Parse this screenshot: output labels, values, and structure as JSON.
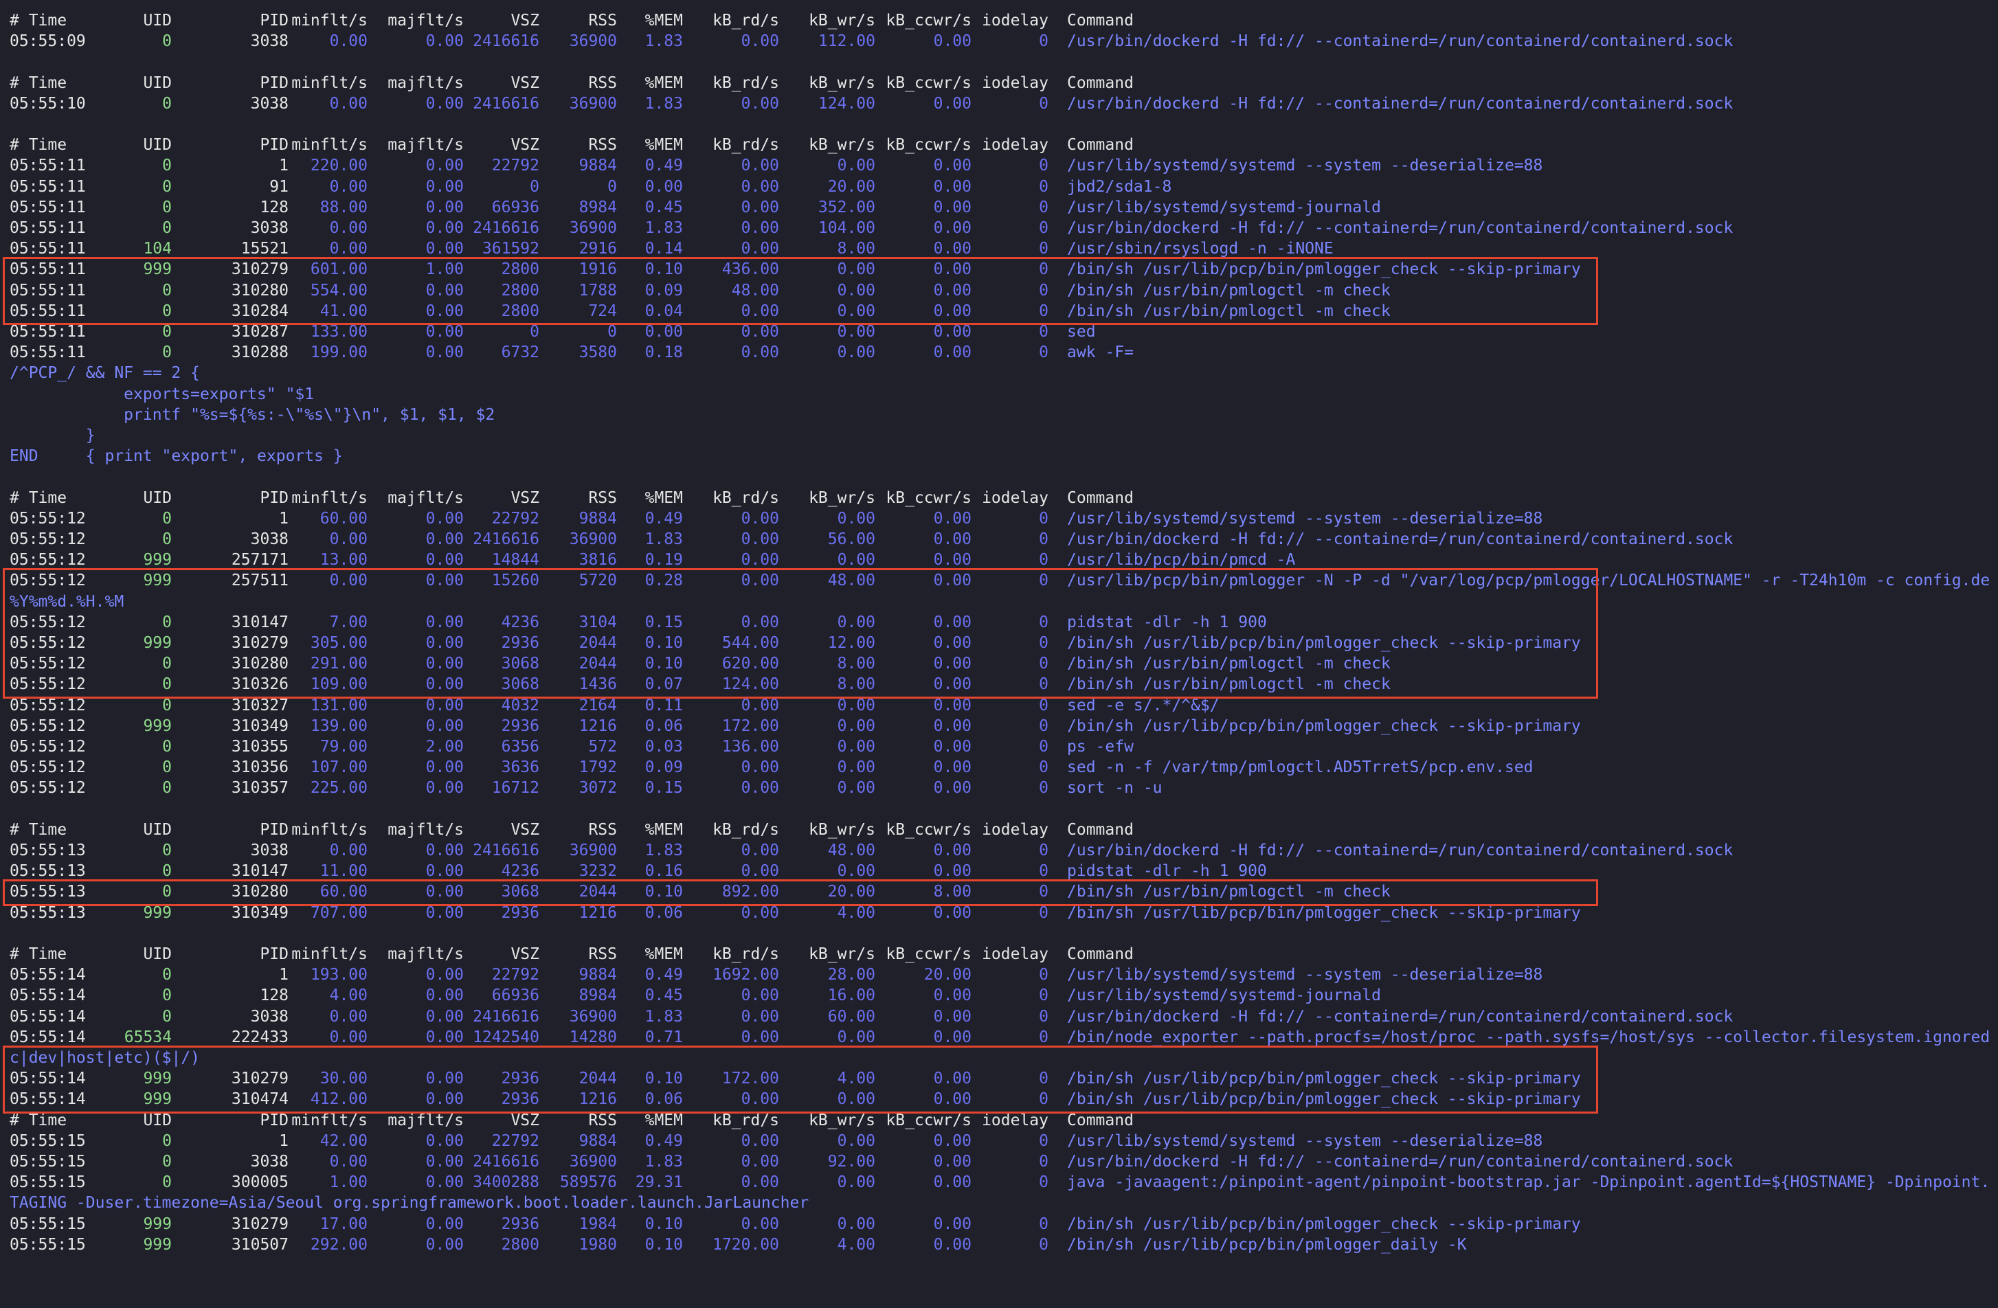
{
  "header": [
    "# Time",
    "UID",
    "PID",
    "minflt/s",
    "majflt/s",
    "VSZ",
    "RSS",
    "%MEM",
    "kB_rd/s",
    "kB_wr/s",
    "kB_ccwr/s",
    "iodelay",
    "Command"
  ],
  "blocks": [
    {
      "rows": [
        [
          "05:55:09",
          "0",
          "3038",
          "0.00",
          "0.00",
          "2416616",
          "36900",
          "1.83",
          "0.00",
          "112.00",
          "0.00",
          "0",
          "/usr/bin/dockerd -H fd:// --containerd=/run/containerd/containerd.sock"
        ]
      ]
    },
    {
      "rows": [
        [
          "05:55:10",
          "0",
          "3038",
          "0.00",
          "0.00",
          "2416616",
          "36900",
          "1.83",
          "0.00",
          "124.00",
          "0.00",
          "0",
          "/usr/bin/dockerd -H fd:// --containerd=/run/containerd/containerd.sock"
        ]
      ]
    },
    {
      "rows": [
        [
          "05:55:11",
          "0",
          "1",
          "220.00",
          "0.00",
          "22792",
          "9884",
          "0.49",
          "0.00",
          "0.00",
          "0.00",
          "0",
          "/usr/lib/systemd/systemd --system --deserialize=88"
        ],
        [
          "05:55:11",
          "0",
          "91",
          "0.00",
          "0.00",
          "0",
          "0",
          "0.00",
          "0.00",
          "20.00",
          "0.00",
          "0",
          "jbd2/sda1-8"
        ],
        [
          "05:55:11",
          "0",
          "128",
          "88.00",
          "0.00",
          "66936",
          "8984",
          "0.45",
          "0.00",
          "352.00",
          "0.00",
          "0",
          "/usr/lib/systemd/systemd-journald"
        ],
        [
          "05:55:11",
          "0",
          "3038",
          "0.00",
          "0.00",
          "2416616",
          "36900",
          "1.83",
          "0.00",
          "104.00",
          "0.00",
          "0",
          "/usr/bin/dockerd -H fd:// --containerd=/run/containerd/containerd.sock"
        ],
        [
          "05:55:11",
          "104",
          "15521",
          "0.00",
          "0.00",
          "361592",
          "2916",
          "0.14",
          "0.00",
          "8.00",
          "0.00",
          "0",
          "/usr/sbin/rsyslogd -n -iNONE"
        ],
        [
          "05:55:11",
          "999",
          "310279",
          "601.00",
          "1.00",
          "2800",
          "1916",
          "0.10",
          "436.00",
          "0.00",
          "0.00",
          "0",
          "/bin/sh /usr/lib/pcp/bin/pmlogger_check --skip-primary"
        ],
        [
          "05:55:11",
          "0",
          "310280",
          "554.00",
          "0.00",
          "2800",
          "1788",
          "0.09",
          "48.00",
          "0.00",
          "0.00",
          "0",
          "/bin/sh /usr/bin/pmlogctl -m check"
        ],
        [
          "05:55:11",
          "0",
          "310284",
          "41.00",
          "0.00",
          "2800",
          "724",
          "0.04",
          "0.00",
          "0.00",
          "0.00",
          "0",
          "/bin/sh /usr/bin/pmlogctl -m check"
        ],
        [
          "05:55:11",
          "0",
          "310287",
          "133.00",
          "0.00",
          "0",
          "0",
          "0.00",
          "0.00",
          "0.00",
          "0.00",
          "0",
          "sed"
        ],
        [
          "05:55:11",
          "0",
          "310288",
          "199.00",
          "0.00",
          "6732",
          "3580",
          "0.18",
          "0.00",
          "0.00",
          "0.00",
          "0",
          "awk -F="
        ],
        {
          "wrap": "/^PCP_/ && NF == 2 {"
        },
        {
          "wrap": "            exports=exports\" \"$1"
        },
        {
          "wrap": "            printf \"%s=${%s:-\\\"%s\\\"}\\n\", $1, $1, $2"
        },
        {
          "wrap": "        }"
        },
        {
          "wrap": "END     { print \"export\", exports }"
        }
      ]
    },
    {
      "rows": [
        [
          "05:55:12",
          "0",
          "1",
          "60.00",
          "0.00",
          "22792",
          "9884",
          "0.49",
          "0.00",
          "0.00",
          "0.00",
          "0",
          "/usr/lib/systemd/systemd --system --deserialize=88"
        ],
        [
          "05:55:12",
          "0",
          "3038",
          "0.00",
          "0.00",
          "2416616",
          "36900",
          "1.83",
          "0.00",
          "56.00",
          "0.00",
          "0",
          "/usr/bin/dockerd -H fd:// --containerd=/run/containerd/containerd.sock"
        ],
        [
          "05:55:12",
          "999",
          "257171",
          "13.00",
          "0.00",
          "14844",
          "3816",
          "0.19",
          "0.00",
          "0.00",
          "0.00",
          "0",
          "/usr/lib/pcp/bin/pmcd -A"
        ],
        [
          "05:55:12",
          "999",
          "257511",
          "0.00",
          "0.00",
          "15260",
          "5720",
          "0.28",
          "0.00",
          "48.00",
          "0.00",
          "0",
          "/usr/lib/pcp/bin/pmlogger -N -P -d \"/var/log/pcp/pmlogger/LOCALHOSTNAME\" -r -T24h10m -c config.de"
        ],
        {
          "wrap": "%Y%m%d.%H.%M"
        },
        [
          "05:55:12",
          "0",
          "310147",
          "7.00",
          "0.00",
          "4236",
          "3104",
          "0.15",
          "0.00",
          "0.00",
          "0.00",
          "0",
          "pidstat -dlr -h 1 900"
        ],
        [
          "05:55:12",
          "999",
          "310279",
          "305.00",
          "0.00",
          "2936",
          "2044",
          "0.10",
          "544.00",
          "12.00",
          "0.00",
          "0",
          "/bin/sh /usr/lib/pcp/bin/pmlogger_check --skip-primary"
        ],
        [
          "05:55:12",
          "0",
          "310280",
          "291.00",
          "0.00",
          "3068",
          "2044",
          "0.10",
          "620.00",
          "8.00",
          "0.00",
          "0",
          "/bin/sh /usr/bin/pmlogctl -m check"
        ],
        [
          "05:55:12",
          "0",
          "310326",
          "109.00",
          "0.00",
          "3068",
          "1436",
          "0.07",
          "124.00",
          "8.00",
          "0.00",
          "0",
          "/bin/sh /usr/bin/pmlogctl -m check"
        ],
        [
          "05:55:12",
          "0",
          "310327",
          "131.00",
          "0.00",
          "4032",
          "2164",
          "0.11",
          "0.00",
          "0.00",
          "0.00",
          "0",
          "sed -e s/.*/^&$/"
        ],
        [
          "05:55:12",
          "999",
          "310349",
          "139.00",
          "0.00",
          "2936",
          "1216",
          "0.06",
          "172.00",
          "0.00",
          "0.00",
          "0",
          "/bin/sh /usr/lib/pcp/bin/pmlogger_check --skip-primary"
        ],
        [
          "05:55:12",
          "0",
          "310355",
          "79.00",
          "2.00",
          "6356",
          "572",
          "0.03",
          "136.00",
          "0.00",
          "0.00",
          "0",
          "ps -efw"
        ],
        [
          "05:55:12",
          "0",
          "310356",
          "107.00",
          "0.00",
          "3636",
          "1792",
          "0.09",
          "0.00",
          "0.00",
          "0.00",
          "0",
          "sed -n -f /var/tmp/pmlogctl.AD5TrretS/pcp.env.sed"
        ],
        [
          "05:55:12",
          "0",
          "310357",
          "225.00",
          "0.00",
          "16712",
          "3072",
          "0.15",
          "0.00",
          "0.00",
          "0.00",
          "0",
          "sort -n -u"
        ]
      ]
    },
    {
      "rows": [
        [
          "05:55:13",
          "0",
          "3038",
          "0.00",
          "0.00",
          "2416616",
          "36900",
          "1.83",
          "0.00",
          "48.00",
          "0.00",
          "0",
          "/usr/bin/dockerd -H fd:// --containerd=/run/containerd/containerd.sock"
        ],
        [
          "05:55:13",
          "0",
          "310147",
          "11.00",
          "0.00",
          "4236",
          "3232",
          "0.16",
          "0.00",
          "0.00",
          "0.00",
          "0",
          "pidstat -dlr -h 1 900"
        ],
        [
          "05:55:13",
          "0",
          "310280",
          "60.00",
          "0.00",
          "3068",
          "2044",
          "0.10",
          "892.00",
          "20.00",
          "8.00",
          "0",
          "/bin/sh /usr/bin/pmlogctl -m check"
        ],
        [
          "05:55:13",
          "999",
          "310349",
          "707.00",
          "0.00",
          "2936",
          "1216",
          "0.06",
          "0.00",
          "4.00",
          "0.00",
          "0",
          "/bin/sh /usr/lib/pcp/bin/pmlogger_check --skip-primary"
        ]
      ]
    },
    {
      "rows": [
        [
          "05:55:14",
          "0",
          "1",
          "193.00",
          "0.00",
          "22792",
          "9884",
          "0.49",
          "1692.00",
          "28.00",
          "20.00",
          "0",
          "/usr/lib/systemd/systemd --system --deserialize=88"
        ],
        [
          "05:55:14",
          "0",
          "128",
          "4.00",
          "0.00",
          "66936",
          "8984",
          "0.45",
          "0.00",
          "16.00",
          "0.00",
          "0",
          "/usr/lib/systemd/systemd-journald"
        ],
        [
          "05:55:14",
          "0",
          "3038",
          "0.00",
          "0.00",
          "2416616",
          "36900",
          "1.83",
          "0.00",
          "60.00",
          "0.00",
          "0",
          "/usr/bin/dockerd -H fd:// --containerd=/run/containerd/containerd.sock"
        ],
        [
          "05:55:14",
          "65534",
          "222433",
          "0.00",
          "0.00",
          "1242540",
          "14280",
          "0.71",
          "0.00",
          "0.00",
          "0.00",
          "0",
          "/bin/node_exporter --path.procfs=/host/proc --path.sysfs=/host/sys --collector.filesystem.ignored"
        ],
        {
          "wrap": "c|dev|host|etc)($|/)"
        },
        [
          "05:55:14",
          "999",
          "310279",
          "30.00",
          "0.00",
          "2936",
          "2044",
          "0.10",
          "172.00",
          "4.00",
          "0.00",
          "0",
          "/bin/sh /usr/lib/pcp/bin/pmlogger_check --skip-primary"
        ],
        [
          "05:55:14",
          "999",
          "310474",
          "412.00",
          "0.00",
          "2936",
          "1216",
          "0.06",
          "0.00",
          "0.00",
          "0.00",
          "0",
          "/bin/sh /usr/lib/pcp/bin/pmlogger_check --skip-primary"
        ]
      ]
    },
    {
      "nogap": true,
      "rows": [
        [
          "05:55:15",
          "0",
          "1",
          "42.00",
          "0.00",
          "22792",
          "9884",
          "0.49",
          "0.00",
          "0.00",
          "0.00",
          "0",
          "/usr/lib/systemd/systemd --system --deserialize=88"
        ],
        [
          "05:55:15",
          "0",
          "3038",
          "0.00",
          "0.00",
          "2416616",
          "36900",
          "1.83",
          "0.00",
          "92.00",
          "0.00",
          "0",
          "/usr/bin/dockerd -H fd:// --containerd=/run/containerd/containerd.sock"
        ],
        [
          "05:55:15",
          "0",
          "300005",
          "1.00",
          "0.00",
          "3400288",
          "589576",
          "29.31",
          "0.00",
          "0.00",
          "0.00",
          "0",
          "java -javaagent:/pinpoint-agent/pinpoint-bootstrap.jar -Dpinpoint.agentId=${HOSTNAME} -Dpinpoint."
        ],
        {
          "wrap": "TAGING -Duser.timezone=Asia/Seoul org.springframework.boot.loader.launch.JarLauncher"
        },
        [
          "05:55:15",
          "999",
          "310279",
          "17.00",
          "0.00",
          "2936",
          "1984",
          "0.10",
          "0.00",
          "0.00",
          "0.00",
          "0",
          "/bin/sh /usr/lib/pcp/bin/pmlogger_check --skip-primary"
        ],
        [
          "05:55:15",
          "999",
          "310507",
          "292.00",
          "0.00",
          "2800",
          "1980",
          "0.10",
          "1720.00",
          "4.00",
          "0.00",
          "0",
          "/bin/sh /usr/lib/pcp/bin/pmlogger_daily -K"
        ]
      ]
    }
  ],
  "colors": {
    "background": "#1f2029",
    "highlight_box": "#e5452e",
    "text": "#e6e6e6",
    "uid": "#8fd98a",
    "numbers": "#6b6ff0",
    "command": "#7b86ff"
  },
  "highlights": [
    {
      "block": 2,
      "from": 5,
      "to": 7
    },
    {
      "block": 3,
      "from": 3,
      "to": 8
    },
    {
      "block": 4,
      "from": 2,
      "to": 2
    },
    {
      "block": 5,
      "from": 4,
      "to": 6
    }
  ]
}
